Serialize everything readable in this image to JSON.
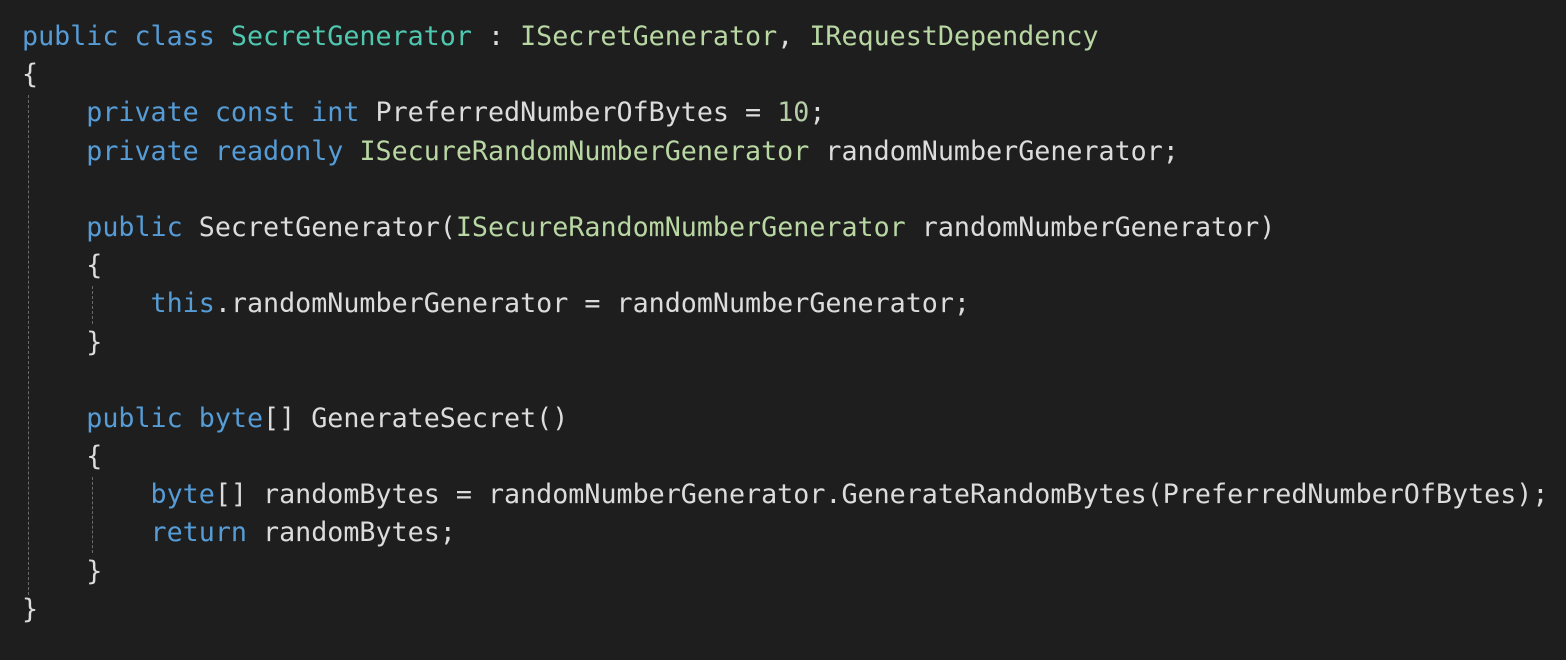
{
  "editor": {
    "colors": {
      "background": "#1e1e1e",
      "keyword": "#569cd6",
      "class": "#4ec9b0",
      "interface": "#b8d7a3",
      "number": "#b5cea8",
      "text": "#dcdcdc"
    },
    "lines": [
      [
        [
          "kw",
          "public class "
        ],
        [
          "cls",
          "SecretGenerator"
        ],
        [
          "txt",
          " : "
        ],
        [
          "iface",
          "ISecretGenerator"
        ],
        [
          "txt",
          ", "
        ],
        [
          "iface",
          "IRequestDependency"
        ]
      ],
      [
        [
          "txt",
          "{"
        ]
      ],
      [
        [
          "txt",
          "    "
        ],
        [
          "kw",
          "private const int "
        ],
        [
          "txt",
          "PreferredNumberOfBytes = "
        ],
        [
          "num",
          "10"
        ],
        [
          "txt",
          ";"
        ]
      ],
      [
        [
          "txt",
          "    "
        ],
        [
          "kw",
          "private readonly "
        ],
        [
          "iface",
          "ISecureRandomNumberGenerator"
        ],
        [
          "txt",
          " randomNumberGenerator;"
        ]
      ],
      [],
      [
        [
          "txt",
          "    "
        ],
        [
          "kw",
          "public "
        ],
        [
          "txt",
          "SecretGenerator("
        ],
        [
          "iface",
          "ISecureRandomNumberGenerator"
        ],
        [
          "txt",
          " randomNumberGenerator)"
        ]
      ],
      [
        [
          "txt",
          "    {"
        ]
      ],
      [
        [
          "txt",
          "        "
        ],
        [
          "kw",
          "this"
        ],
        [
          "txt",
          ".randomNumberGenerator = randomNumberGenerator;"
        ]
      ],
      [
        [
          "txt",
          "    }"
        ]
      ],
      [],
      [
        [
          "txt",
          "    "
        ],
        [
          "kw",
          "public byte"
        ],
        [
          "txt",
          "[] GenerateSecret()"
        ]
      ],
      [
        [
          "txt",
          "    {"
        ]
      ],
      [
        [
          "txt",
          "        "
        ],
        [
          "kw",
          "byte"
        ],
        [
          "txt",
          "[] randomBytes = randomNumberGenerator.GenerateRandomBytes(PreferredNumberOfBytes);"
        ]
      ],
      [
        [
          "txt",
          "        "
        ],
        [
          "kw",
          "return"
        ],
        [
          "txt",
          " randomBytes;"
        ]
      ],
      [
        [
          "txt",
          "    }"
        ]
      ],
      [
        [
          "txt",
          "}"
        ]
      ]
    ]
  }
}
